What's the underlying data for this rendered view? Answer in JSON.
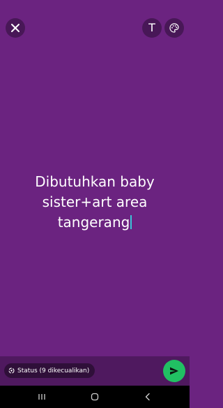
{
  "top_bar": {
    "close_icon": "close-icon",
    "text_tool_label": "T",
    "palette_icon": "palette-icon"
  },
  "editor": {
    "lines": [
      "Dibutuhkan baby",
      "sister+art area",
      "tangerang"
    ],
    "background_color": "#6b2380"
  },
  "bottom_bar": {
    "status_chip_label": "Status (9 dikecualikan)",
    "status_chip_icon": "status-icon",
    "send_icon": "send-icon",
    "send_color": "#21c063"
  },
  "nav": {
    "recent_icon": "recent-apps-icon",
    "home_icon": "home-icon",
    "back_icon": "back-icon"
  }
}
